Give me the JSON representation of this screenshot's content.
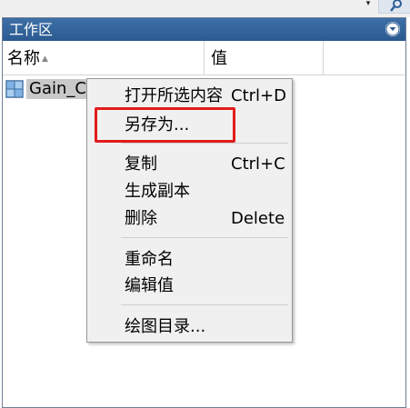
{
  "workspace": {
    "title": "工作区",
    "columns": {
      "name": "名称",
      "value": "值"
    },
    "rows": [
      {
        "name": "Gain_Co"
      }
    ]
  },
  "context_menu": {
    "items": [
      {
        "label": "打开所选内容",
        "shortcut": "Ctrl+D"
      },
      {
        "label": "另存为..."
      },
      {
        "label": "复制",
        "shortcut": "Ctrl+C"
      },
      {
        "label": "生成副本"
      },
      {
        "label": "删除",
        "shortcut": "Delete"
      },
      {
        "label": "重命名"
      },
      {
        "label": "编辑值"
      },
      {
        "label": "绘图目录..."
      }
    ]
  },
  "colors": {
    "titlebar": "#2f6199",
    "highlight_border": "#e21b1b",
    "selected_row": "#c9c9c9"
  },
  "icons": [
    "dropdown-arrow-icon",
    "search-icon",
    "collapse-icon",
    "sort-ascending-icon",
    "matrix-variable-icon"
  ]
}
